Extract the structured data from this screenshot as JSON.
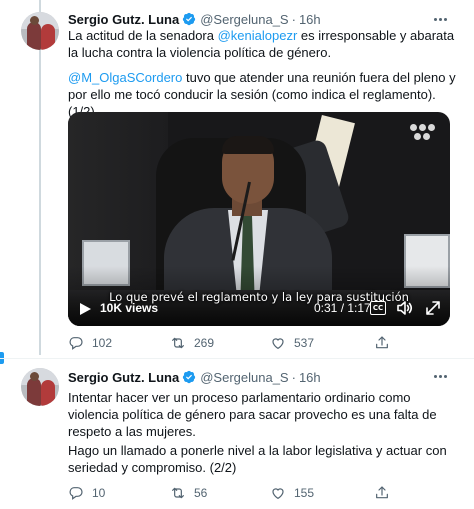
{
  "tweets": [
    {
      "author": {
        "name": "Sergio Gutz. Luna",
        "handle": "@Sergeluna_S",
        "time": "16h",
        "verified": true
      },
      "paragraphs": [
        {
          "before": "La actitud de la senadora ",
          "mention": "@kenialopezr",
          "after": " es irresponsable y abarata la lucha contra la violencia política de género."
        },
        {
          "before": "",
          "mention": "@M_OlgaSCordero",
          "after": " tuvo que atender una reunión fuera del pleno y por ello me tocó conducir la sesión (como indica el reglamento). (1/2)"
        }
      ],
      "video": {
        "subtitle": "Lo que prevé el reglamento y la ley para sustitución",
        "views": "10K views",
        "duration": "0:31 / 1:17",
        "cc_label": "CC"
      },
      "actions": {
        "replies": "102",
        "retweets": "269",
        "likes": "537"
      }
    },
    {
      "author": {
        "name": "Sergio Gutz. Luna",
        "handle": "@Sergeluna_S",
        "time": "16h",
        "verified": true
      },
      "paragraphs": [
        {
          "text": "Intentar hacer ver un proceso parlamentario ordinario como violencia política de género para sacar provecho es una falta de respeto a las mujeres."
        },
        {
          "text": "Hago un llamado a ponerle nivel a la labor legislativa y actuar con seriedad y compromiso. (2/2)"
        }
      ],
      "actions": {
        "replies": "10",
        "retweets": "56",
        "likes": "155"
      }
    }
  ],
  "separator": "·",
  "colors": {
    "accent": "#1d9bf0",
    "text": "#0f1419",
    "muted": "#536471"
  },
  "icons": [
    "verified-badge-icon",
    "more-icon",
    "reply-icon",
    "retweet-icon",
    "like-icon",
    "share-icon",
    "play-icon",
    "closed-captions-icon",
    "volume-icon",
    "expand-icon"
  ]
}
